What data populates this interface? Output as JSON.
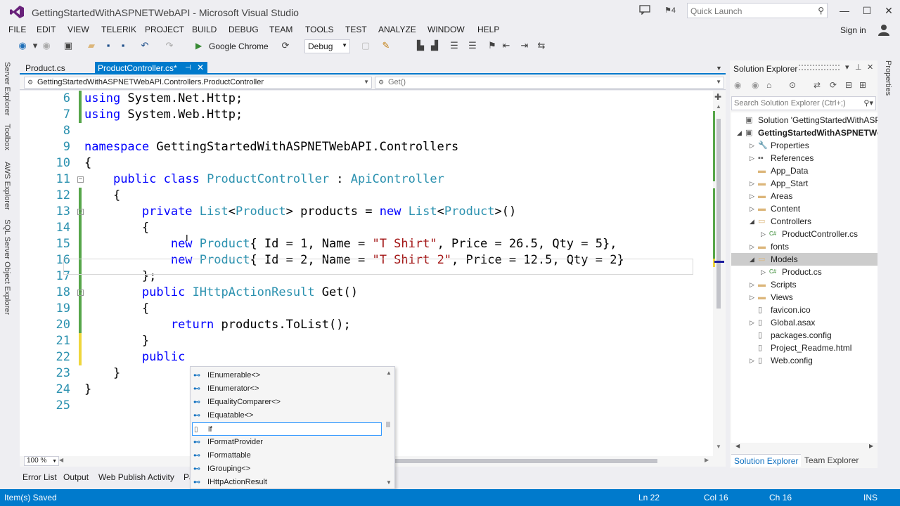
{
  "window": {
    "title": "GettingStartedWithASPNETWebAPI - Microsoft Visual Studio",
    "notification_count": "4",
    "quick_launch_placeholder": "Quick Launch"
  },
  "menu": [
    "FILE",
    "EDIT",
    "VIEW",
    "TELERIK",
    "PROJECT",
    "BUILD",
    "DEBUG",
    "TEAM",
    "TOOLS",
    "TEST",
    "ANALYZE",
    "WINDOW",
    "HELP"
  ],
  "account": {
    "signin_label": "Sign in"
  },
  "toolbar": {
    "run_target": "Google Chrome",
    "configuration": "Debug"
  },
  "left_tool_tabs": [
    "Server Explorer",
    "Toolbox",
    "AWS Explorer",
    "SQL Server Object Explorer"
  ],
  "right_tool_tabs": [
    "Properties"
  ],
  "document_tabs": [
    {
      "label": "Product.cs",
      "active": false
    },
    {
      "label": "ProductController.cs*",
      "active": true
    }
  ],
  "navbar": {
    "class_path": "GettingStartedWithASPNETWebAPI.Controllers.ProductController",
    "member": "Get()"
  },
  "editor": {
    "zoom": "100 %",
    "lines": [
      {
        "num": "6",
        "text": "using System.Net.Http;"
      },
      {
        "num": "7",
        "text": "using System.Web.Http;"
      },
      {
        "num": "8",
        "text": ""
      },
      {
        "num": "9",
        "text": "namespace GettingStartedWithASPNETWebAPI.Controllers"
      },
      {
        "num": "10",
        "text": "{"
      },
      {
        "num": "11",
        "text": "    public class ProductController : ApiController"
      },
      {
        "num": "12",
        "text": "    {"
      },
      {
        "num": "13",
        "text": "        private List<Product> products = new List<Product>()"
      },
      {
        "num": "14",
        "text": "        {"
      },
      {
        "num": "15",
        "text": "            new Product{ Id = 1, Name = \"T Shirt\", Price = 26.5, Qty = 5},"
      },
      {
        "num": "16",
        "text": "            new Product{ Id = 2, Name = \"T Shirt 2\", Price = 12.5, Qty = 2}"
      },
      {
        "num": "17",
        "text": "        };"
      },
      {
        "num": "18",
        "text": "        public IHttpActionResult Get()"
      },
      {
        "num": "19",
        "text": "        {"
      },
      {
        "num": "20",
        "text": "            return products.ToList();"
      },
      {
        "num": "21",
        "text": "        }"
      },
      {
        "num": "22",
        "text": "        public "
      },
      {
        "num": "23",
        "text": "    }"
      },
      {
        "num": "24",
        "text": "}"
      },
      {
        "num": "25",
        "text": ""
      }
    ]
  },
  "intellisense": {
    "items": [
      {
        "label": "IEnumerable<>",
        "kind": "interface"
      },
      {
        "label": "IEnumerator<>",
        "kind": "interface"
      },
      {
        "label": "IEqualityComparer<>",
        "kind": "interface"
      },
      {
        "label": "IEquatable<>",
        "kind": "interface"
      },
      {
        "label": "if",
        "kind": "snippet",
        "selected": true
      },
      {
        "label": "IFormatProvider",
        "kind": "interface"
      },
      {
        "label": "IFormattable",
        "kind": "interface"
      },
      {
        "label": "IGrouping<>",
        "kind": "interface"
      },
      {
        "label": "IHttpActionResult",
        "kind": "interface"
      }
    ]
  },
  "bottom_tabs": [
    "Error List",
    "Output",
    "Web Publish Activity",
    "Pa"
  ],
  "solution_explorer": {
    "title": "Solution Explorer",
    "search_placeholder": "Search Solution Explorer (Ctrl+;)",
    "nodes": [
      {
        "label": "Solution 'GettingStartedWithASPNETWebAPI'",
        "indent": 0,
        "icon": "solution",
        "arrow": ""
      },
      {
        "label": "GettingStartedWithASPNETWebAPI",
        "indent": 0,
        "icon": "project",
        "arrow": "expanded",
        "bold": true
      },
      {
        "label": "Properties",
        "indent": 1,
        "icon": "wrench",
        "arrow": "collapsed"
      },
      {
        "label": "References",
        "indent": 1,
        "icon": "references",
        "arrow": "collapsed"
      },
      {
        "label": "App_Data",
        "indent": 1,
        "icon": "folder",
        "arrow": ""
      },
      {
        "label": "App_Start",
        "indent": 1,
        "icon": "folder",
        "arrow": "collapsed"
      },
      {
        "label": "Areas",
        "indent": 1,
        "icon": "folder",
        "arrow": "collapsed"
      },
      {
        "label": "Content",
        "indent": 1,
        "icon": "folder",
        "arrow": "collapsed"
      },
      {
        "label": "Controllers",
        "indent": 1,
        "icon": "folder-open",
        "arrow": "expanded"
      },
      {
        "label": "ProductController.cs",
        "indent": 2,
        "icon": "cs-file",
        "arrow": "collapsed"
      },
      {
        "label": "fonts",
        "indent": 1,
        "icon": "folder",
        "arrow": "collapsed"
      },
      {
        "label": "Models",
        "indent": 1,
        "icon": "folder-open",
        "arrow": "expanded",
        "selected": true
      },
      {
        "label": "Product.cs",
        "indent": 2,
        "icon": "cs-file",
        "arrow": "collapsed"
      },
      {
        "label": "Scripts",
        "indent": 1,
        "icon": "folder",
        "arrow": "collapsed"
      },
      {
        "label": "Views",
        "indent": 1,
        "icon": "folder",
        "arrow": "collapsed"
      },
      {
        "label": "favicon.ico",
        "indent": 1,
        "icon": "file",
        "arrow": ""
      },
      {
        "label": "Global.asax",
        "indent": 1,
        "icon": "file",
        "arrow": "collapsed"
      },
      {
        "label": "packages.config",
        "indent": 1,
        "icon": "file",
        "arrow": ""
      },
      {
        "label": "Project_Readme.html",
        "indent": 1,
        "icon": "file",
        "arrow": ""
      },
      {
        "label": "Web.config",
        "indent": 1,
        "icon": "file",
        "arrow": "collapsed"
      }
    ],
    "tabs": [
      "Solution Explorer",
      "Team Explorer"
    ]
  },
  "status": {
    "message": "Item(s) Saved",
    "ln": "Ln 22",
    "col": "Col 16",
    "ch": "Ch 16",
    "mode": "INS"
  },
  "colors": {
    "accent": "#007acc",
    "keyword": "#0000ff",
    "type": "#2b91af",
    "string": "#a31515",
    "change_saved": "#57a64a",
    "change_unsaved": "#efd63c"
  }
}
